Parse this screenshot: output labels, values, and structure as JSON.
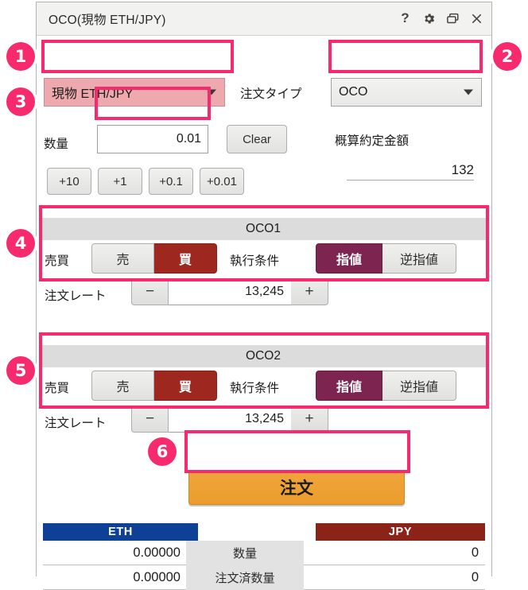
{
  "window": {
    "title": "OCO(現物 ETH/JPY)",
    "controls": [
      {
        "name": "help-button",
        "glyph": "?"
      },
      {
        "name": "settings-gear-button",
        "glyph": "gear-icon"
      },
      {
        "name": "restore-window-button",
        "glyph": "restore-icon"
      },
      {
        "name": "close-window-button",
        "glyph": "close-icon"
      }
    ]
  },
  "top": {
    "pair_value": "現物 ETH/JPY",
    "order_type_label": "注文タイプ",
    "order_type_value": "OCO"
  },
  "quantity": {
    "label": "数量",
    "value": "0.01",
    "clear_label": "Clear",
    "add_buttons": [
      "+10",
      "+1",
      "+0.1",
      "+0.01"
    ],
    "estimate_label": "概算約定金額",
    "estimate_value": "132"
  },
  "oco1": {
    "header": "OCO1",
    "side_label": "売買",
    "sell_label": "売",
    "buy_label": "買",
    "condition_label": "執行条件",
    "limit_label": "指値",
    "stop_limit_label": "逆指値",
    "rate_label": "注文レート",
    "minus_label": "−",
    "plus_label": "+",
    "rate_value": "13,245"
  },
  "oco2": {
    "header": "OCO2",
    "side_label": "売買",
    "sell_label": "売",
    "buy_label": "買",
    "condition_label": "執行条件",
    "limit_label": "指値",
    "stop_limit_label": "逆指値",
    "rate_label": "注文レート",
    "minus_label": "−",
    "plus_label": "+",
    "rate_value": "13,245"
  },
  "submit": {
    "label": "注文"
  },
  "balance_table": {
    "headers": {
      "left": "ETH",
      "middle": "",
      "right": "JPY"
    },
    "rows": [
      {
        "left": "0.00000",
        "center": "数量",
        "right": "0"
      },
      {
        "left": "0.00000",
        "center": "注文済数量",
        "right": "0"
      }
    ]
  },
  "annotations": {
    "badges": [
      "①",
      "②",
      "③",
      "④",
      "⑤",
      "⑥"
    ],
    "digits": [
      "1",
      "2",
      "3",
      "4",
      "5",
      "6"
    ],
    "accent_color": "#f72a6e"
  },
  "colors": {
    "buy": "#9e2820",
    "limit": "#7d2450",
    "submit": "#eb9c2c",
    "eth_header": "#0e4195",
    "jpy_header": "#8c2318",
    "highlight_fill": "#eda9ad"
  }
}
